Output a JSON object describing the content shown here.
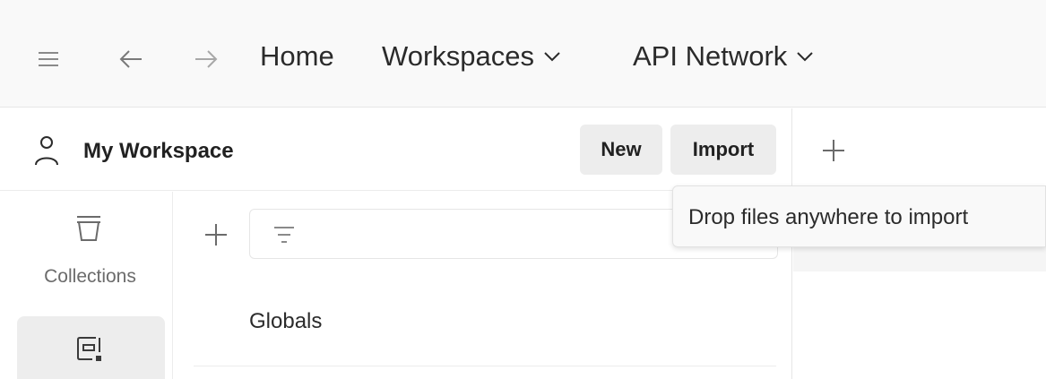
{
  "topbar": {
    "menu_icon": "hamburger-menu-icon",
    "back_icon": "arrow-left-icon",
    "forward_icon": "arrow-right-icon",
    "home_label": "Home",
    "workspaces_label": "Workspaces",
    "api_network_label": "API Network"
  },
  "workspace": {
    "user_icon": "user-icon",
    "title": "My Workspace",
    "new_label": "New",
    "import_label": "Import"
  },
  "tabs": {
    "add_icon": "plus-icon"
  },
  "tooltip": {
    "text": "Drop files anywhere to import"
  },
  "rail": {
    "items": [
      {
        "icon": "trash-collections-icon",
        "label": "Collections",
        "active": false
      },
      {
        "icon": "environment-icon",
        "label": "",
        "active": true
      }
    ]
  },
  "panel": {
    "add_icon": "plus-icon",
    "filter_icon": "filter-icon",
    "items": [
      {
        "label": "Globals"
      }
    ]
  },
  "colors": {
    "topbar_bg": "#f9f9f9",
    "button_bg": "#ededed",
    "text": "#212121",
    "muted_text": "#6b6b6b",
    "border": "#e6e6e6"
  }
}
